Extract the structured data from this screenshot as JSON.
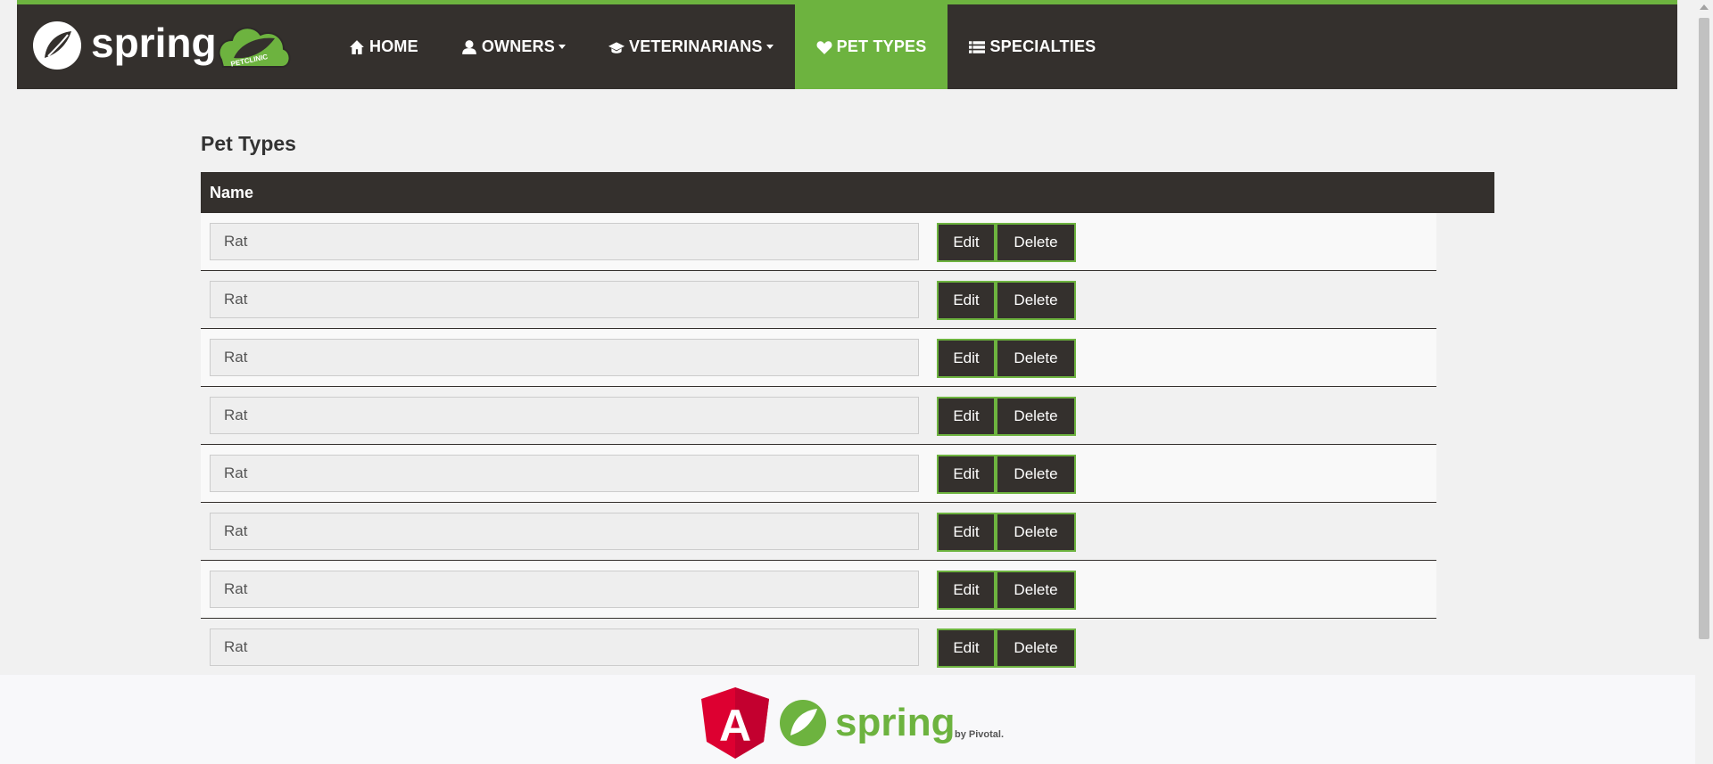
{
  "brand": {
    "logo_text": "spring",
    "badge_text": "PETCLINIC"
  },
  "nav": {
    "items": [
      {
        "label": "HOME",
        "icon": "home-icon",
        "dropdown": false,
        "active": false
      },
      {
        "label": "OWNERS",
        "icon": "user-icon",
        "dropdown": true,
        "active": false
      },
      {
        "label": "VETERINARIANS",
        "icon": "graduation-cap-icon",
        "dropdown": true,
        "active": false
      },
      {
        "label": "PET TYPES",
        "icon": "heart-icon",
        "dropdown": false,
        "active": true
      },
      {
        "label": "SPECIALTIES",
        "icon": "list-icon",
        "dropdown": false,
        "active": false
      }
    ]
  },
  "page": {
    "title": "Pet Types"
  },
  "table": {
    "header": "Name",
    "rows": [
      {
        "name": "Rat"
      },
      {
        "name": "Rat"
      },
      {
        "name": "Rat"
      },
      {
        "name": "Rat"
      },
      {
        "name": "Rat"
      },
      {
        "name": "Rat"
      },
      {
        "name": "Rat"
      },
      {
        "name": "Rat"
      }
    ],
    "edit_label": "Edit",
    "delete_label": "Delete"
  },
  "footer": {
    "framework_letter": "A",
    "spring_text": "spring",
    "pivotal_text": "by Pivotal."
  },
  "colors": {
    "accent": "#6db33f",
    "dark": "#34302d",
    "angular_red": "#dd0031"
  }
}
